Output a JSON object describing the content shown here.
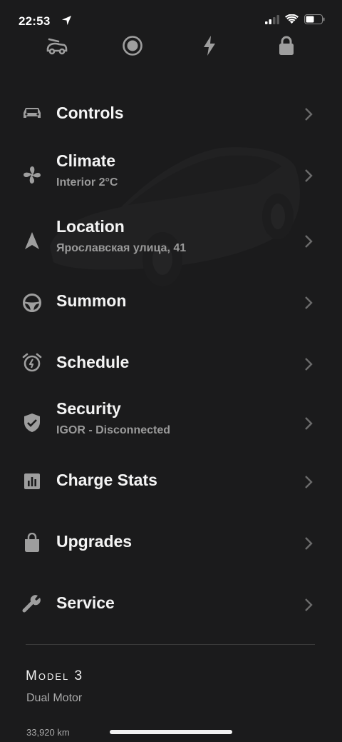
{
  "status_bar": {
    "time": "22:53",
    "signal_bars": 4,
    "battery_level": 0.5
  },
  "quick_actions": [
    {
      "name": "frunk-icon"
    },
    {
      "name": "record-icon"
    },
    {
      "name": "charge-icon"
    },
    {
      "name": "lock-icon"
    }
  ],
  "menu": {
    "items": [
      {
        "title": "Controls",
        "subtitle": "",
        "icon": "car-icon"
      },
      {
        "title": "Climate",
        "subtitle": "Interior 2°C",
        "icon": "fan-icon"
      },
      {
        "title": "Location",
        "subtitle": "Ярославская улица, 41",
        "icon": "navigation-arrow-icon"
      },
      {
        "title": "Summon",
        "subtitle": "",
        "icon": "steering-wheel-icon"
      },
      {
        "title": "Schedule",
        "subtitle": "",
        "icon": "alarm-clock-icon"
      },
      {
        "title": "Security",
        "subtitle": "IGOR - Disconnected",
        "icon": "shield-check-icon"
      },
      {
        "title": "Charge Stats",
        "subtitle": "",
        "icon": "bar-chart-icon"
      },
      {
        "title": "Upgrades",
        "subtitle": "",
        "icon": "shopping-bag-icon"
      },
      {
        "title": "Service",
        "subtitle": "",
        "icon": "wrench-icon"
      }
    ]
  },
  "vehicle": {
    "model": "Model 3",
    "variant": "Dual Motor",
    "odometer": "33,920 km"
  },
  "colors": {
    "background": "#1b1b1c",
    "text_primary": "#f4f4f4",
    "text_secondary": "#9a9a9a",
    "icon": "#9e9e9e",
    "chevron": "#6b6b6b",
    "divider": "#3a3a3a"
  }
}
